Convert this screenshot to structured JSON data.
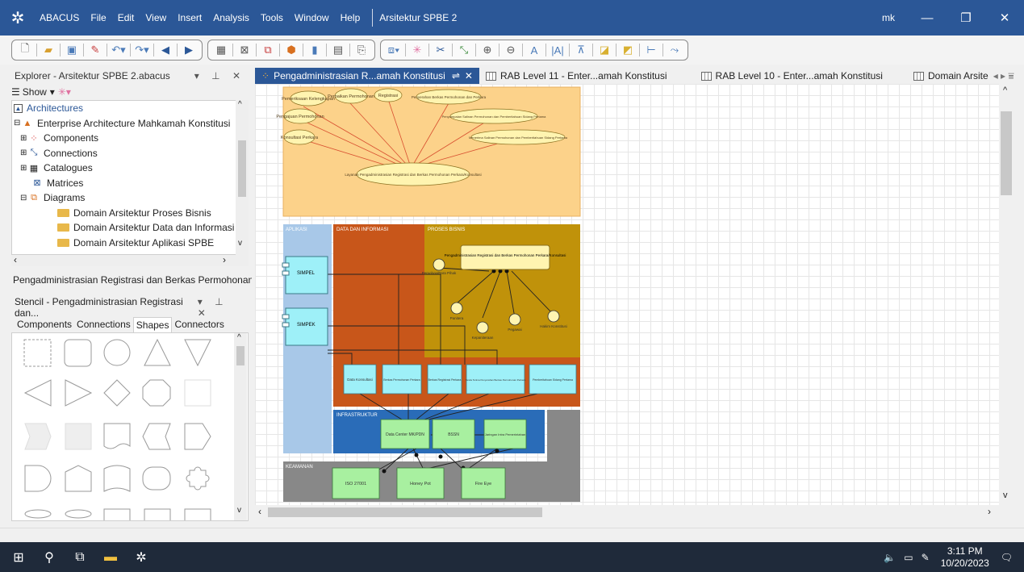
{
  "window": {
    "app_name": "ABACUS",
    "menu": [
      "File",
      "Edit",
      "View",
      "Insert",
      "Analysis",
      "Tools",
      "Window",
      "Help"
    ],
    "document_title": "Arsitektur SPBE 2",
    "user": "mk",
    "accent": "#2b5797"
  },
  "explorer": {
    "title": "Explorer - Arsitektur SPBE 2.abacus",
    "show_label": "Show",
    "tree": [
      {
        "label": "Architectures",
        "icon": "architectures-icon"
      },
      {
        "label": "Enterprise Architecture Mahkamah Konstitusi",
        "icon": "architecture-icon"
      },
      {
        "label": "Components",
        "icon": "components-icon"
      },
      {
        "label": "Connections",
        "icon": "connections-icon"
      },
      {
        "label": "Catalogues",
        "icon": "catalogue-icon"
      },
      {
        "label": "Matrices",
        "icon": "matrix-icon"
      },
      {
        "label": "Diagrams",
        "icon": "diagrams-icon"
      },
      {
        "label": "Domain Arsitektur Proses Bisnis",
        "icon": "folder-icon"
      },
      {
        "label": "Domain Arsitektur Data dan Informasi",
        "icon": "folder-icon"
      },
      {
        "label": "Domain Arsitektur Aplikasi SPBE",
        "icon": "folder-icon"
      }
    ]
  },
  "selected_item": "Pengadministrasian Registrasi dan Berkas Permohonan Perkara",
  "stencil": {
    "title": "Stencil - Pengadministrasian Registrasi dan...",
    "tabs": [
      "Components",
      "Connections",
      "Shapes",
      "Connectors"
    ],
    "active_tab": "Shapes"
  },
  "doc_tabs": [
    {
      "label": "Pengadministrasian R...amah Konstitusi",
      "active": true
    },
    {
      "label": "RAB Level 11 - Enter...amah Konstitusi",
      "active": false
    },
    {
      "label": "RAB Level 10 - Enter...amah Konstitusi",
      "active": false
    },
    {
      "label": "Domain Arsite",
      "active": false
    }
  ],
  "diagram": {
    "usecases_top": [
      "Pemeriksaan Kelengkapan",
      "Perbaikan Permohonan",
      "Registrasi",
      "Penyerahan Berkas Permohonan dan Perkara",
      "Pengajuan Permohonan",
      "Penyampaian Salinan Permohonan dan Pemberitahuan Sidang Pertama",
      "Konsultasi Perkara",
      "Menerima Salinan Permohonan dan Pemberitahuan Sidang Pertama"
    ],
    "usecase_main": "Layanan Pengadministrasian Registrasi dan Berkas Permohonan Perkara/Konsultasi",
    "lanes": {
      "aplikasi": "APLIKASI",
      "data": "DATA DAN INFORMASI",
      "proses": "PROSES BISNIS",
      "infrastruktur": "INFRASTRUKTUR",
      "keamanan": "KEAMANAN"
    },
    "apps": [
      "SIMPEL",
      "SIMPEK"
    ],
    "process_main": "Pengadministrasian Registrasi dan Berkas Permohonan Perkara/Konsultasi",
    "actors": [
      "Pemohon/Para Pihak",
      "Panitera",
      "Kepaniteraan",
      "Pegawai",
      "Hakim Konstitusi"
    ],
    "data_items": [
      "Data Konsultasi",
      "Berkas Permohonan Perkara",
      "Berkas Registrasi Perkara",
      "Tanda Terima Penyerahan Berkas Permohonan Perkara",
      "Pemberitahuan Sidang Pertama"
    ],
    "infra_items": [
      "Data Center MK/PDN",
      "BSSN",
      "Jaringan Intra Pemerintahan"
    ],
    "security_items": [
      "ISO 27001",
      "Honey Pot",
      "Fire Eye"
    ]
  },
  "taskbar": {
    "time": "3:11 PM",
    "date": "10/20/2023"
  }
}
